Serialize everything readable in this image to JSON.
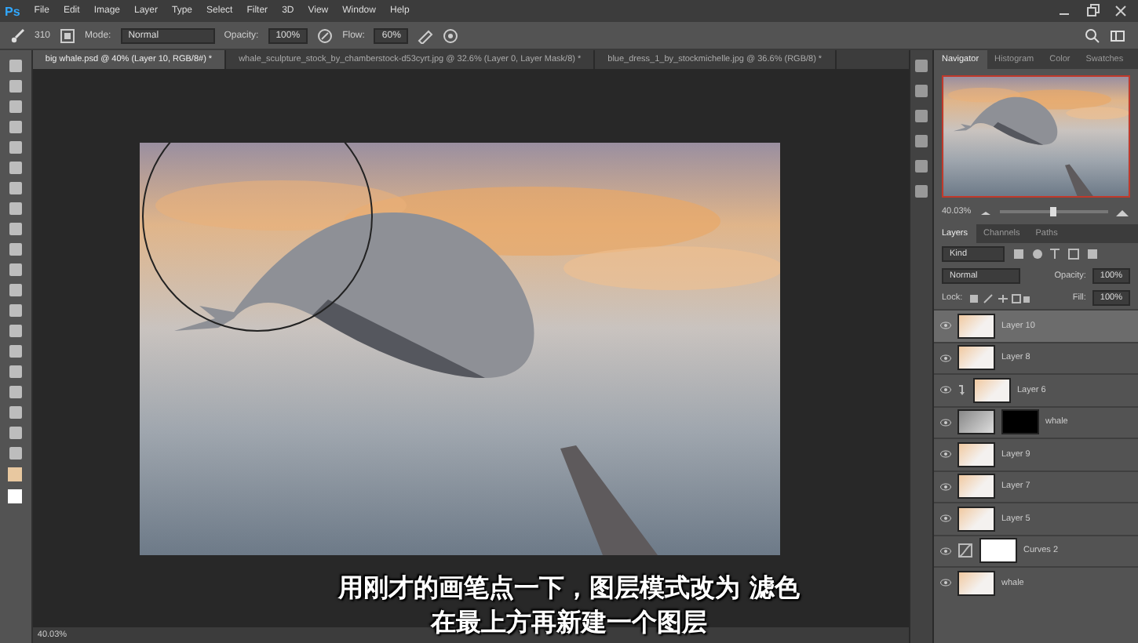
{
  "menu_bar": {
    "logo": "Ps",
    "items": [
      "File",
      "Edit",
      "Image",
      "Layer",
      "Type",
      "Select",
      "Filter",
      "3D",
      "View",
      "Window",
      "Help"
    ]
  },
  "options_bar": {
    "brush_size": "310",
    "mode_label": "Mode:",
    "mode": "Normal",
    "opacity_label": "Opacity:",
    "opacity": "100%",
    "flow_label": "Flow:",
    "flow": "60%"
  },
  "document_tabs": [
    {
      "label": "big whale.psd @ 40% (Layer 10, RGB/8#) *",
      "selected": true
    },
    {
      "label": "whale_sculpture_stock_by_chamberstock-d53cyrt.jpg @ 32.6% (Layer 0, Layer Mask/8) *",
      "selected": false
    },
    {
      "label": "blue_dress_1_by_stockmichelle.jpg @ 36.6% (RGB/8) *",
      "selected": false
    }
  ],
  "status_bar": {
    "zoom": "40.03%"
  },
  "navigator": {
    "tabs": [
      {
        "label": "Navigator",
        "selected": true
      },
      {
        "label": "Histogram",
        "selected": false
      },
      {
        "label": "Color",
        "selected": false
      },
      {
        "label": "Swatches",
        "selected": false
      }
    ],
    "zoom": "40.03%",
    "level": 0.5
  },
  "layers_panel": {
    "tabs": [
      {
        "label": "Layers",
        "selected": true
      },
      {
        "label": "Channels",
        "selected": false
      },
      {
        "label": "Paths",
        "selected": false
      }
    ],
    "filter": "Kind",
    "blend_mode": "Normal",
    "opacity_label": "Opacity:",
    "opacity": "100%",
    "lock_label": "Lock:",
    "fill_label": "Fill:",
    "fill": "100%",
    "layers": [
      {
        "name": "Layer 10",
        "kind": "pixel",
        "selected": true,
        "clipped": false
      },
      {
        "name": "Layer 8",
        "kind": "pixel",
        "selected": false,
        "clipped": false
      },
      {
        "name": "Layer 6",
        "kind": "pixel",
        "selected": false,
        "clipped": true
      },
      {
        "name": "whale",
        "kind": "masked",
        "selected": false,
        "clipped": false
      },
      {
        "name": "Layer 9",
        "kind": "pixel",
        "selected": false,
        "clipped": false
      },
      {
        "name": "Layer 7",
        "kind": "pixel",
        "selected": false,
        "clipped": false
      },
      {
        "name": "Layer 5",
        "kind": "pixel",
        "selected": false,
        "clipped": false
      },
      {
        "name": "Curves 2",
        "kind": "adjustment",
        "selected": false,
        "clipped": false
      },
      {
        "name": "whale",
        "kind": "pixel",
        "selected": false,
        "clipped": false
      }
    ]
  },
  "subtitles": [
    "用刚才的画笔点一下，图层模式改为 滤色",
    "在最上方再新建一个图层"
  ]
}
